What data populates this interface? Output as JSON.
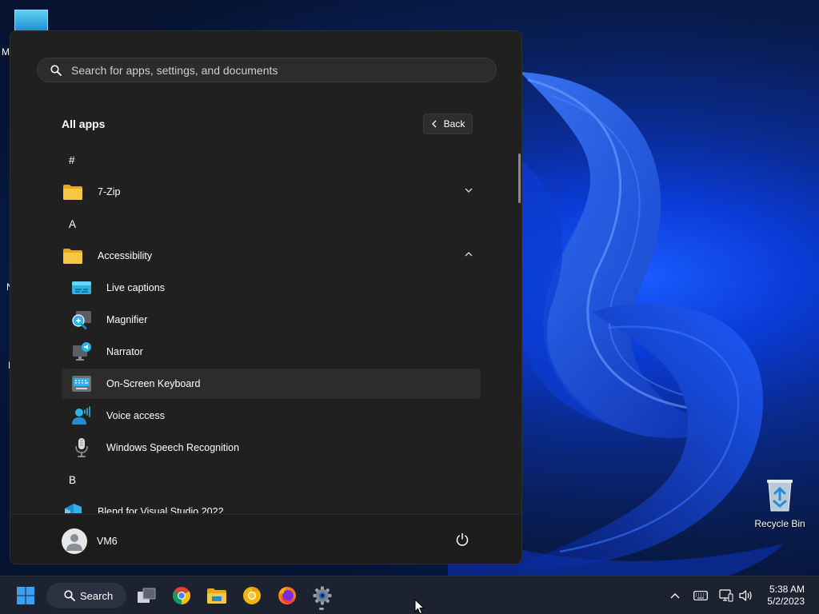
{
  "desktop": {
    "edge_letters": [
      "M",
      "N",
      "I"
    ],
    "recycle_bin_label": "Recycle Bin"
  },
  "start_menu": {
    "search_placeholder": "Search for apps, settings, and documents",
    "all_apps_title": "All apps",
    "back_label": "Back",
    "sections": {
      "hash": "#",
      "a": "A",
      "b": "B"
    },
    "apps": {
      "seven_zip": "7-Zip",
      "accessibility": "Accessibility",
      "live_captions": "Live captions",
      "magnifier": "Magnifier",
      "narrator": "Narrator",
      "on_screen_keyboard": "On-Screen Keyboard",
      "voice_access": "Voice access",
      "speech_recognition": "Windows Speech Recognition",
      "blend": "Blend for Visual Studio 2022"
    },
    "user_name": "VM6"
  },
  "taskbar": {
    "search_label": "Search",
    "time": "5:38 AM",
    "date": "5/2/2023"
  },
  "colors": {
    "menu_bg": "#202020",
    "folder_yellow": "#f2c13c",
    "accent_blue": "#0f78d7"
  },
  "icons": [
    "start-icon",
    "search-icon",
    "task-view-icon",
    "chrome-icon",
    "file-explorer-icon",
    "chrome-canary-icon",
    "firefox-icon",
    "settings-icon",
    "chevron-up-icon",
    "keyboard-icon",
    "network-icon",
    "volume-icon",
    "power-icon",
    "recycle-bin-icon"
  ]
}
